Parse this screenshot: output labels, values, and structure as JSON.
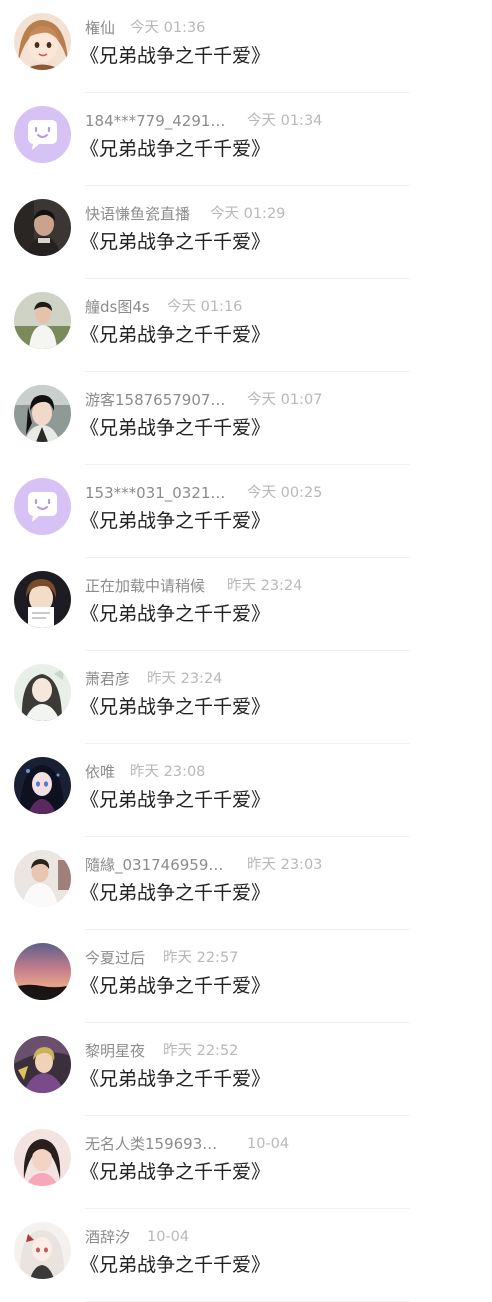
{
  "colors": {
    "placeholder_avatar": "#d7c2f5",
    "name": "#8c8c8c",
    "time": "#b8b8b8",
    "title": "#222222"
  },
  "items": [
    {
      "name": "権仙",
      "time": "今天 01:36",
      "title": "《兄弟战争之千千爱》",
      "avatar": "anime-girl-avatar"
    },
    {
      "name": "184***779_4291…",
      "time": "今天 01:34",
      "title": "《兄弟战争之千千爱》",
      "avatar": "default-chat-bubble-avatar"
    },
    {
      "name": "快语慊鱼瓷直播",
      "time": "今天 01:29",
      "title": "《兄弟战争之千千爱》",
      "avatar": "dark-portrait-avatar"
    },
    {
      "name": "艟ds图4s",
      "time": "今天 01:16",
      "title": "《兄弟战争之千千爱》",
      "avatar": "man-photo-avatar"
    },
    {
      "name": "游客1587657907…",
      "time": "今天 01:07",
      "title": "《兄弟战争之千千爱》",
      "avatar": "drama-actor-avatar"
    },
    {
      "name": "153***031_0321…",
      "time": "今天 00:25",
      "title": "《兄弟战争之千千爱》",
      "avatar": "default-chat-bubble-avatar"
    },
    {
      "name": "正在加载中请稍候",
      "time": "昨天 23:24",
      "title": "《兄弟战争之千千爱》",
      "avatar": "anime-boy-avatar"
    },
    {
      "name": "萧君彦",
      "time": "昨天 23:24",
      "title": "《兄弟战争之千千爱》",
      "avatar": "ancient-style-avatar"
    },
    {
      "name": "依唯",
      "time": "昨天 23:08",
      "title": "《兄弟战争之千千爱》",
      "avatar": "anime-dark-avatar"
    },
    {
      "name": "隨緣_031746959…",
      "time": "昨天 23:03",
      "title": "《兄弟战争之千千爱》",
      "avatar": "man-white-shirt-avatar"
    },
    {
      "name": "今夏过后",
      "time": "昨天 22:57",
      "title": "《兄弟战争之千千爱》",
      "avatar": "sunset-sky-avatar"
    },
    {
      "name": "黎明星夜",
      "time": "昨天 22:52",
      "title": "《兄弟战争之千千爱》",
      "avatar": "fantasy-art-avatar"
    },
    {
      "name": "无名人类159693…",
      "time": "10-04",
      "title": "《兄弟战争之千千爱》",
      "avatar": "girl-photo-avatar"
    },
    {
      "name": "酒辞汐",
      "time": "10-04",
      "title": "《兄弟战争之千千爱》",
      "avatar": "anime-white-hair-avatar"
    }
  ]
}
